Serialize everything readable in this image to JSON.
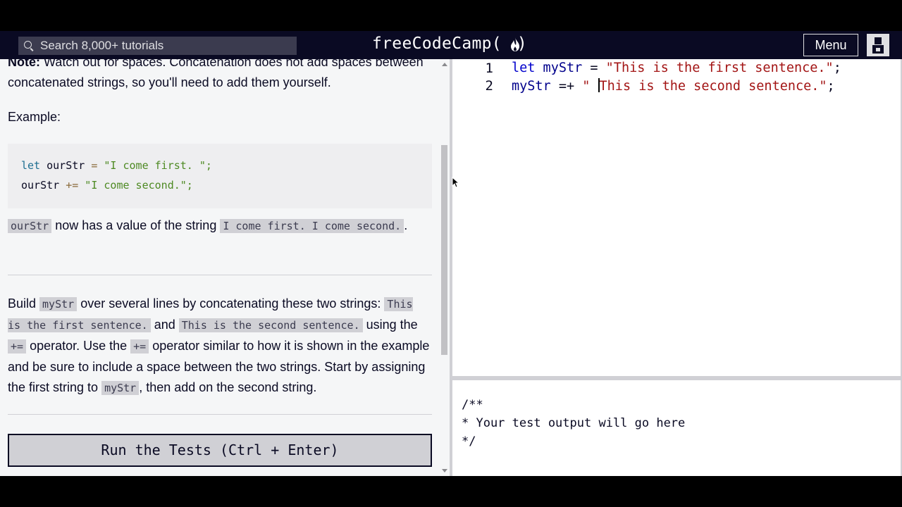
{
  "nav": {
    "search_placeholder": "Search 8,000+ tutorials",
    "logo_text": "freeCodeCamp(",
    "logo_close": ")",
    "menu_label": "Menu",
    "icons": {
      "search": "search-icon",
      "flame": "flame-icon",
      "avatar": "avatar-icon"
    }
  },
  "lesson": {
    "note_bold": "Note:",
    "note_text": " Watch out for spaces. Concatenation does not add spaces between concatenated strings, so you'll need to add them yourself.",
    "example_label": "Example:",
    "example_code": {
      "line1": {
        "kw": "let",
        "name": " ourStr ",
        "op": "=",
        "str": " \"I come first. \";"
      },
      "line2": {
        "name": "ourStr ",
        "op": "+=",
        "str": " \"I come second.\";"
      }
    },
    "result": {
      "code1": "ourStr",
      "text1": " now has a value of the string ",
      "code2": "I come first. I come second.",
      "text2": "."
    },
    "task": {
      "t1": "Build ",
      "c1": "myStr",
      "t2": " over several lines by concatenating these two strings: ",
      "c2": "This is the first sentence.",
      "t3": " and ",
      "c3": "This is the second sentence.",
      "t4": " using the ",
      "c4": "+=",
      "t5": " operator. Use the ",
      "c5": "+=",
      "t6": " operator similar to how it is shown in the example and be sure to include a space between the two strings. Start by assigning the first string to ",
      "c6": "myStr",
      "t7": ", then add on the second string."
    },
    "run_button": "Run the Tests (Ctrl + Enter)"
  },
  "editor": {
    "lines": [
      {
        "num": "1",
        "kw": "let",
        "name": " myStr ",
        "op": "= ",
        "str": "\"This is the first sentence.\"",
        "end": ";"
      },
      {
        "num": "2",
        "name": "myStr ",
        "op": "=+ ",
        "str_before_cursor": "\" ",
        "str_after_cursor": "This is the second sentence.\"",
        "end": ";"
      }
    ]
  },
  "output": {
    "lines": [
      "/**",
      "* Your test output will go here",
      "*/"
    ]
  }
}
